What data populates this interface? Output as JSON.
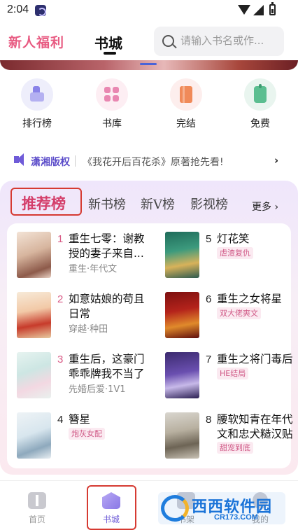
{
  "status_bar": {
    "time": "2:04"
  },
  "header": {
    "newbie_tab": "新人福利",
    "bookcity_tab": "书城",
    "search_placeholder": "请输入书名或作..."
  },
  "quick_entries": [
    {
      "label": "排行榜",
      "icon": "ranking-icon",
      "color": "#8a83e8"
    },
    {
      "label": "书库",
      "icon": "library-icon",
      "color": "#e987b1"
    },
    {
      "label": "完结",
      "icon": "completed-icon",
      "color": "#f08a59"
    },
    {
      "label": "免费",
      "icon": "free-tag-icon",
      "color": "#5bbe90"
    }
  ],
  "announcement": {
    "source": "潇湘版权",
    "text": "《我花开后百花杀》原著抢先看!",
    "arrow": "›"
  },
  "ranking": {
    "tabs": [
      "推荐榜",
      "新书榜",
      "新V榜",
      "影视榜"
    ],
    "active_tab": "推荐榜",
    "more": "更多 ›",
    "accent_color": "#d43e6a",
    "books": [
      {
        "rank": "1",
        "title": "重生七零：谢教授的妻子来自...",
        "meta": "重生·年代文",
        "tag": ""
      },
      {
        "rank": "2",
        "title": "如意姑娘的苟且日常",
        "meta": "穿越·种田",
        "tag": ""
      },
      {
        "rank": "3",
        "title": "重生后，这豪门乖乖牌我不当了",
        "meta": "先婚后爱·1V1",
        "tag": ""
      },
      {
        "rank": "4",
        "title": "簪星",
        "meta": "",
        "tag": "炮灰女配"
      },
      {
        "rank": "5",
        "title": "灯花笑",
        "meta": "",
        "tag": "虐渣复仇"
      },
      {
        "rank": "6",
        "title": "重生之女将星",
        "meta": "",
        "tag": "双大佬爽文"
      },
      {
        "rank": "7",
        "title": "重生之将门毒后",
        "meta": "",
        "tag": "HE结局"
      },
      {
        "rank": "8",
        "title": "腰软知青在年代文和忠犬糙汉贴贴",
        "meta": "",
        "tag": "甜宠到底"
      }
    ]
  },
  "bottom_nav": [
    {
      "label": "首页",
      "icon": "home-icon"
    },
    {
      "label": "书城",
      "icon": "bookcity-icon"
    },
    {
      "label": "书架",
      "icon": "bookshelf-icon"
    },
    {
      "label": "我的",
      "icon": "profile-icon"
    }
  ],
  "bottom_nav_active": "书城",
  "watermark": {
    "name": "西西软件园",
    "domain": "CR173.COM"
  }
}
